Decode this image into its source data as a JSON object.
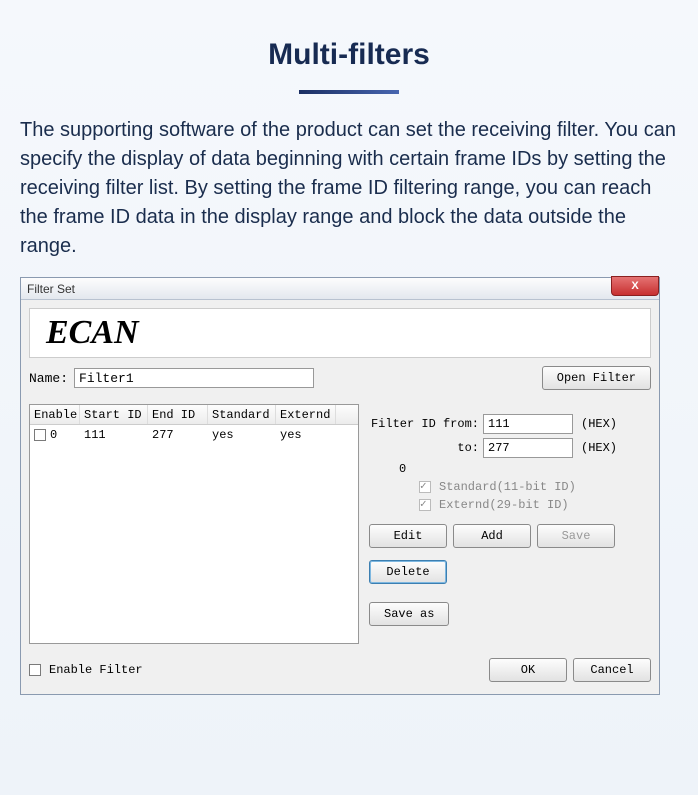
{
  "page": {
    "title": "Multi-filters",
    "description": "The supporting software of the product can set the receiving filter. You can specify the display of data beginning with certain frame IDs by setting the receiving filter list. By setting the frame ID filtering range, you can reach the frame ID data in the display range and block the data outside the range."
  },
  "dialog": {
    "title": "Filter Set",
    "close": "X",
    "logo": "ECAN",
    "name_label": "Name:",
    "name_value": "Filter1",
    "open_btn": "Open Filter",
    "table": {
      "headers": {
        "enable": "Enable",
        "start": "Start ID",
        "end": "End ID",
        "standard": "Standard",
        "externd": "Externd"
      },
      "rows": [
        {
          "enable_num": "0",
          "start": "111",
          "end": "277",
          "standard": "yes",
          "externd": "yes"
        }
      ]
    },
    "filter_from_label": "Filter ID from:",
    "filter_from_value": "111",
    "filter_to_label": "to:",
    "filter_to_value": "277",
    "hex_label": "(HEX)",
    "zero_label": "0",
    "standard_chk": "Standard(11-bit ID)",
    "externd_chk": "Externd(29-bit ID)",
    "edit_btn": "Edit",
    "add_btn": "Add",
    "save_btn": "Save",
    "delete_btn": "Delete",
    "saveas_btn": "Save as",
    "enable_filter_label": "Enable Filter",
    "ok_btn": "OK",
    "cancel_btn": "Cancel"
  }
}
